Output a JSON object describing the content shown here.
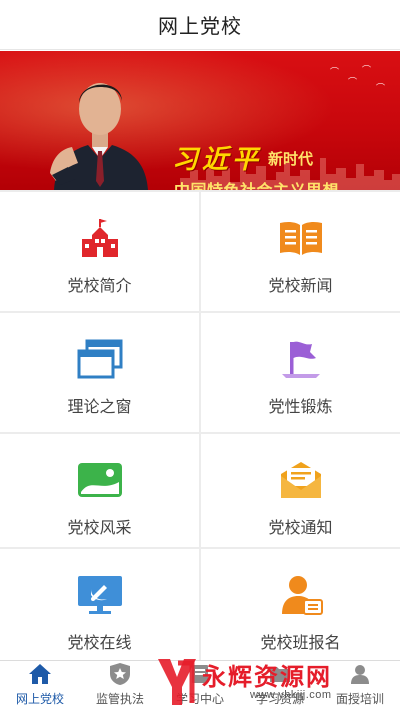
{
  "header": {
    "title": "网上党校"
  },
  "banner": {
    "calligraphy": "习近平",
    "era": "新时代",
    "thought": "中国特色社会主义思想"
  },
  "menu": [
    {
      "label": "党校简介",
      "icon": "school-building-icon",
      "color": "#e0262b"
    },
    {
      "label": "党校新闻",
      "icon": "open-book-icon",
      "color": "#f08a1c"
    },
    {
      "label": "理论之窗",
      "icon": "windows-icon",
      "color": "#2f7fc4"
    },
    {
      "label": "党性锻炼",
      "icon": "flag-icon",
      "color": "#9b5fd6"
    },
    {
      "label": "党校风采",
      "icon": "landscape-image-icon",
      "color": "#3cb34a"
    },
    {
      "label": "党校通知",
      "icon": "envelope-icon",
      "color": "#f0a21c"
    },
    {
      "label": "党校在线",
      "icon": "party-emblem-monitor-icon",
      "color": "#3f8fd8"
    },
    {
      "label": "党校班报名",
      "icon": "user-registration-icon",
      "color": "#f08a1c"
    }
  ],
  "tabs": [
    {
      "label": "网上党校",
      "icon": "home-icon",
      "active": true
    },
    {
      "label": "监管执法",
      "icon": "shield-star-icon",
      "active": false
    },
    {
      "label": "学习中心",
      "icon": "book-icon",
      "active": false
    },
    {
      "label": "学习资源",
      "icon": "folder-icon",
      "active": false
    },
    {
      "label": "面授培训",
      "icon": "teacher-icon",
      "active": false
    }
  ],
  "watermark": {
    "text": "永辉资源网",
    "url": "www.yhkjjj.com"
  },
  "colors": {
    "primary_red": "#c8070c",
    "active_blue": "#1e5aa8",
    "grid_bg": "#ececec"
  }
}
